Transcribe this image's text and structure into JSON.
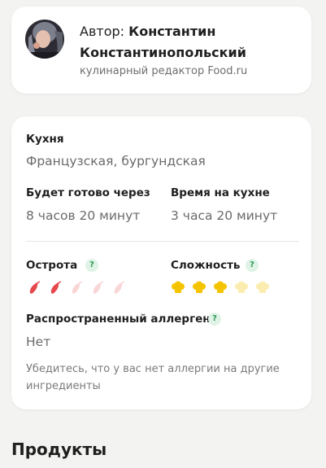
{
  "author": {
    "prefix": "Автор:",
    "name": "Константин Константинопольский",
    "role": "кулинарный редактор Food.ru"
  },
  "details": {
    "cuisine_label": "Кухня",
    "cuisine_value": "Французская, бургундская",
    "ready_label": "Будет готово через",
    "ready_value": "8 часов 20 минут",
    "kitchen_label": "Время на кухне",
    "kitchen_value": "3 часа  20 минут",
    "spiciness_label": "Острота",
    "spiciness_level": 2,
    "spiciness_max": 5,
    "difficulty_label": "Сложность",
    "difficulty_level": 3,
    "difficulty_max": 5,
    "allergen_label": "Распространенный аллерген",
    "allergen_value": "Нет",
    "allergen_note": "Убедитесь, что у вас нет аллергии на другие ингредиенты",
    "help_glyph": "?"
  },
  "products": {
    "title": "Продукты"
  },
  "colors": {
    "pepper_active": "#e5484d",
    "pepper_inactive": "#f9d6d6",
    "chef_active": "#f5c400",
    "chef_inactive": "#fbedb0"
  },
  "icons": {
    "avatar": "author-avatar",
    "help": "question-icon",
    "pepper": "pepper-icon",
    "chef": "chef-hat-icon"
  }
}
